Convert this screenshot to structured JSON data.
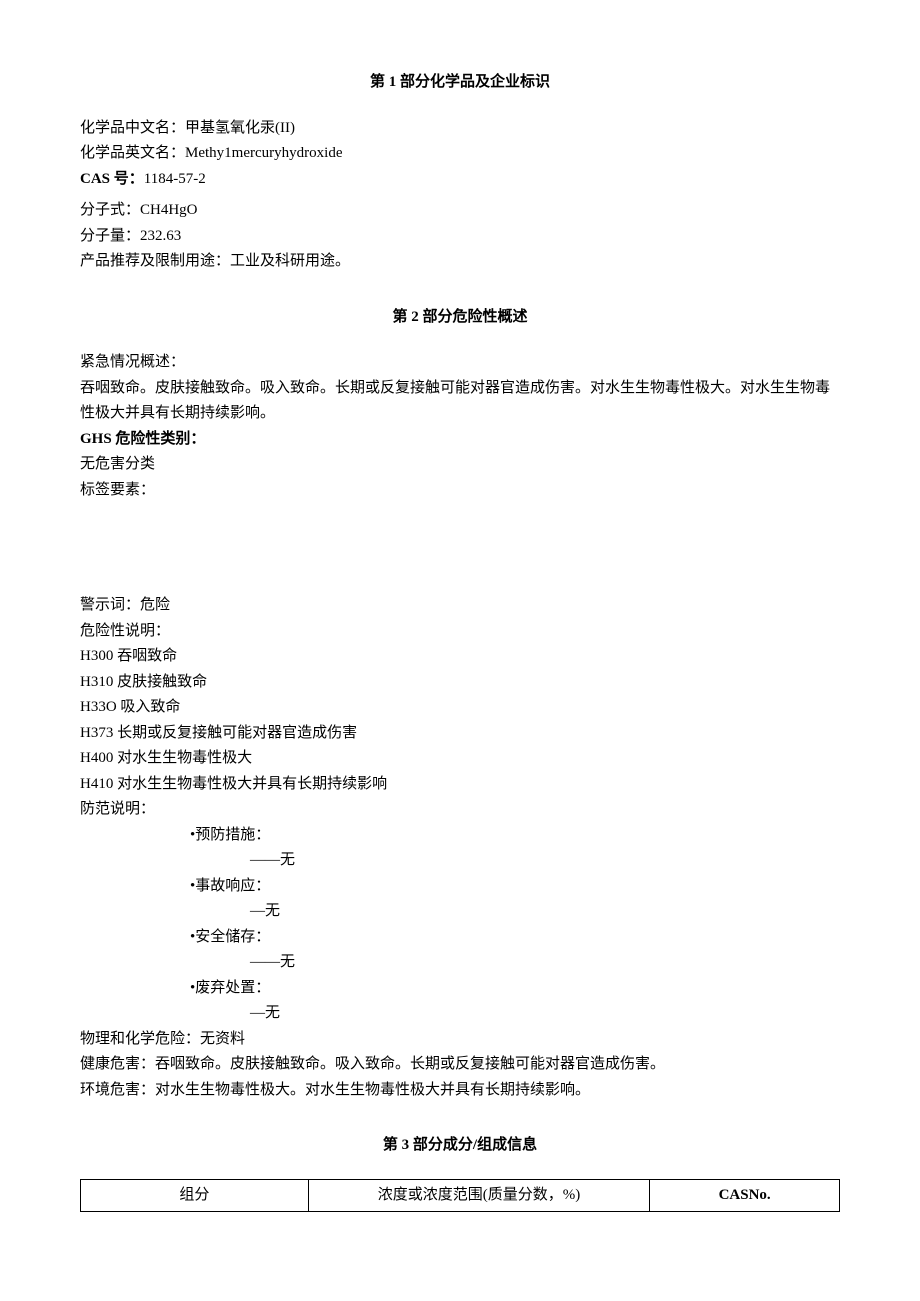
{
  "section1": {
    "title": "第 1 部分化学品及企业标识",
    "name_cn_label": "化学品中文名：",
    "name_cn_value": "甲基氢氧化汞(II)",
    "name_en_label": "化学品英文名：",
    "name_en_value": "Methy1mercuryhydroxide",
    "cas_label": "CAS 号：",
    "cas_value": "1184-57-2",
    "formula_label": "分子式：",
    "formula_value": "CH4HgO",
    "mw_label": "分子量：",
    "mw_value": "232.63",
    "usage_label": "产品推荐及限制用途：",
    "usage_value": "工业及科研用途。"
  },
  "section2": {
    "title": "第 2 部分危险性概述",
    "emergency_label": "紧急情况概述：",
    "emergency_text": "吞咽致命。皮肤接触致命。吸入致命。长期或反复接触可能对器官造成伤害。对水生生物毒性极大。对水生生物毒性极大并具有长期持续影响。",
    "ghs_label": "GHS 危险性类别：",
    "ghs_value": "无危害分类",
    "label_elements_label": "标签要素：",
    "signal_label": "警示词：",
    "signal_value": "危险",
    "hazard_stmt_label": "危险性说明：",
    "hazard_statements": [
      "H300 吞咽致命",
      "H310 皮肤接触致命",
      "H33O 吸入致命",
      "H373 长期或反复接触可能对器官造成伤害",
      "H400 对水生生物毒性极大",
      "H410 对水生生物毒性极大并具有长期持续影响"
    ],
    "precaution_label": "防范说明：",
    "precautions": [
      {
        "head": "•预防措施：",
        "body": "——无"
      },
      {
        "head": "•事故响应：",
        "body": "—无"
      },
      {
        "head": "•安全储存：",
        "body": "——无"
      },
      {
        "head": "•废弃处置：",
        "body": "—无"
      }
    ],
    "physchem_label": "物理和化学危险：",
    "physchem_value": "无资料",
    "health_label": "健康危害：",
    "health_value": "吞咽致命。皮肤接触致命。吸入致命。长期或反复接触可能对器官造成伤害。",
    "env_label": "环境危害：",
    "env_value": "对水生生物毒性极大。对水生生物毒性极大并具有长期持续影响。"
  },
  "section3": {
    "title": "第 3 部分成分/组成信息",
    "table_headers": {
      "component": "组分",
      "concentration": "浓度或浓度范围(质量分数，%)",
      "cas": "CASNo."
    }
  }
}
